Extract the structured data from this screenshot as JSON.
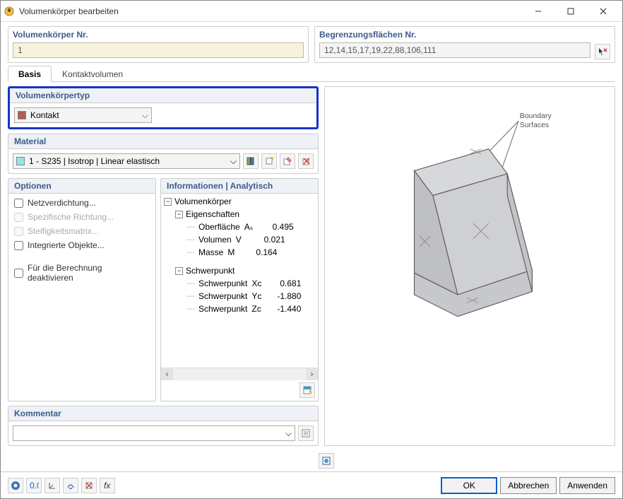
{
  "window": {
    "title": "Volumenkörper bearbeiten"
  },
  "solid_no": {
    "label": "Volumenkörper Nr.",
    "value": "1"
  },
  "boundary": {
    "label": "Begrenzungsflächen Nr.",
    "value": "12,14,15,17,19,22,88,106,111"
  },
  "tabs": {
    "basis": "Basis",
    "kontakt": "Kontaktvolumen"
  },
  "type_panel": {
    "label": "Volumenkörpertyp",
    "value": "Kontakt"
  },
  "material_panel": {
    "label": "Material",
    "value": "1 - S235 | Isotrop | Linear elastisch"
  },
  "options_panel": {
    "label": "Optionen",
    "items": {
      "mesh": "Netzverdichtung...",
      "specdir": "Spezifische Richtung...",
      "stiff": "Steifigkeitsmatrix...",
      "intobj": "Integrierte Objekte...",
      "deact": "Für die Berechnung deaktivieren"
    }
  },
  "info_panel": {
    "label": "Informationen | Analytisch",
    "root": "Volumenkörper",
    "props": "Eigenschaften",
    "rows": {
      "surface": {
        "label": "Oberfläche",
        "sym": "Aₛ",
        "val": "0.495"
      },
      "volume": {
        "label": "Volumen",
        "sym": "V",
        "val": "0.021"
      },
      "mass": {
        "label": "Masse",
        "sym": "M",
        "val": "0.164"
      }
    },
    "centroid": "Schwerpunkt",
    "crow": {
      "x": {
        "label": "Schwerpunkt",
        "sym": "Xc",
        "val": "0.681"
      },
      "y": {
        "label": "Schwerpunkt",
        "sym": "Yc",
        "val": "-1.880"
      },
      "z": {
        "label": "Schwerpunkt",
        "sym": "Zc",
        "val": "-1.440"
      }
    }
  },
  "comment_panel": {
    "label": "Kommentar",
    "value": ""
  },
  "preview": {
    "label": "Boundary\nSurfaces"
  },
  "buttons": {
    "ok": "OK",
    "cancel": "Abbrechen",
    "apply": "Anwenden"
  }
}
